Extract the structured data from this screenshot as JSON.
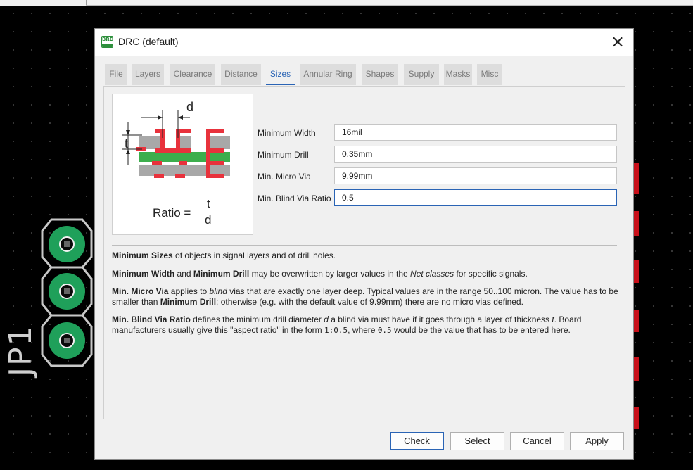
{
  "background": {
    "part_label": "JP1"
  },
  "dialog": {
    "icon_text": "BRD",
    "title": "DRC (default)",
    "close_symbol": "×",
    "tabs": [
      {
        "label": "File"
      },
      {
        "label": "Layers"
      },
      {
        "label": "Clearance"
      },
      {
        "label": "Distance"
      },
      {
        "label": "Sizes",
        "active": true
      },
      {
        "label": "Annular Ring"
      },
      {
        "label": "Shapes"
      },
      {
        "label": "Supply"
      },
      {
        "label": "Masks"
      },
      {
        "label": "Misc"
      }
    ],
    "diagram": {
      "label_d": "d",
      "label_t": "t",
      "ratio_label": "Ratio =",
      "ratio_numerator": "t",
      "ratio_denominator": "d"
    },
    "fields": [
      {
        "label": "Minimum Width",
        "value": "16mil"
      },
      {
        "label": "Minimum Drill",
        "value": "0.35mm"
      },
      {
        "label": "Min. Micro Via",
        "value": "9.99mm"
      },
      {
        "label": "Min. Blind Via Ratio",
        "value": "0.5"
      }
    ],
    "description": {
      "p1_bold": "Minimum Sizes",
      "p1_text": " of objects in signal layers and of drill holes.",
      "p2_bold1": "Minimum Width",
      "p2_text1": " and ",
      "p2_bold2": "Minimum Drill",
      "p2_text2": " may be overwritten by larger values in the ",
      "p2_italic": "Net classes",
      "p2_text3": " for specific signals.",
      "p3_bold1": "Min. Micro Via",
      "p3_text1": " applies to ",
      "p3_italic": "blind",
      "p3_text2": " vias that are exactly one layer deep. Typical values are in the range 50..100 micron. The value has to be smaller than ",
      "p3_bold2": "Minimum Drill",
      "p3_text3": "; otherwise (e.g. with the default value of 9.99mm) there are no micro vias defined.",
      "p4_bold": "Min. Blind Via Ratio",
      "p4_text1": " defines the minimum drill diameter ",
      "p4_italic1": "d",
      "p4_text2": " a blind via must have if it goes through a layer of thickness ",
      "p4_italic2": "t",
      "p4_text3": ". Board manufacturers usually give this \"aspect ratio\" in the form ",
      "p4_code1": "1:0.5",
      "p4_text4": ", where ",
      "p4_code2": "0.5",
      "p4_text5": " would be the value that has to be entered here."
    },
    "buttons": {
      "check": "Check",
      "select": "Select",
      "cancel": "Cancel",
      "apply": "Apply"
    }
  },
  "colors": {
    "accent": "#2a64b5",
    "copper_red": "#e8323c",
    "pad_green": "#1fa05a",
    "dialog_bg": "#f0f0f0"
  }
}
